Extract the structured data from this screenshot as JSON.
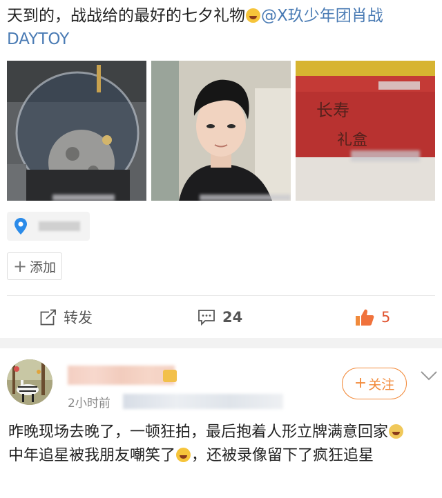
{
  "post": {
    "text_before": "天到的，战战给的最好的七夕礼物",
    "mention": "@X玖少年团肖战DAYTOY"
  },
  "actions": {
    "add_label": "添加",
    "repost_label": "转发",
    "comment_count": "24",
    "like_count": "5"
  },
  "comment": {
    "time": "2小时前",
    "follow_label": "关注",
    "line1": "昨晚现场去晚了，一顿狂拍，最后抱着人形立牌满意回家",
    "line2_before": "中年追星被我朋友嘲笑了",
    "line2_after": "，还被录像留下了疯狂追星"
  },
  "colors": {
    "mention": "#4a7bb4",
    "like": "#e0532f",
    "follow": "#f28a3a"
  }
}
